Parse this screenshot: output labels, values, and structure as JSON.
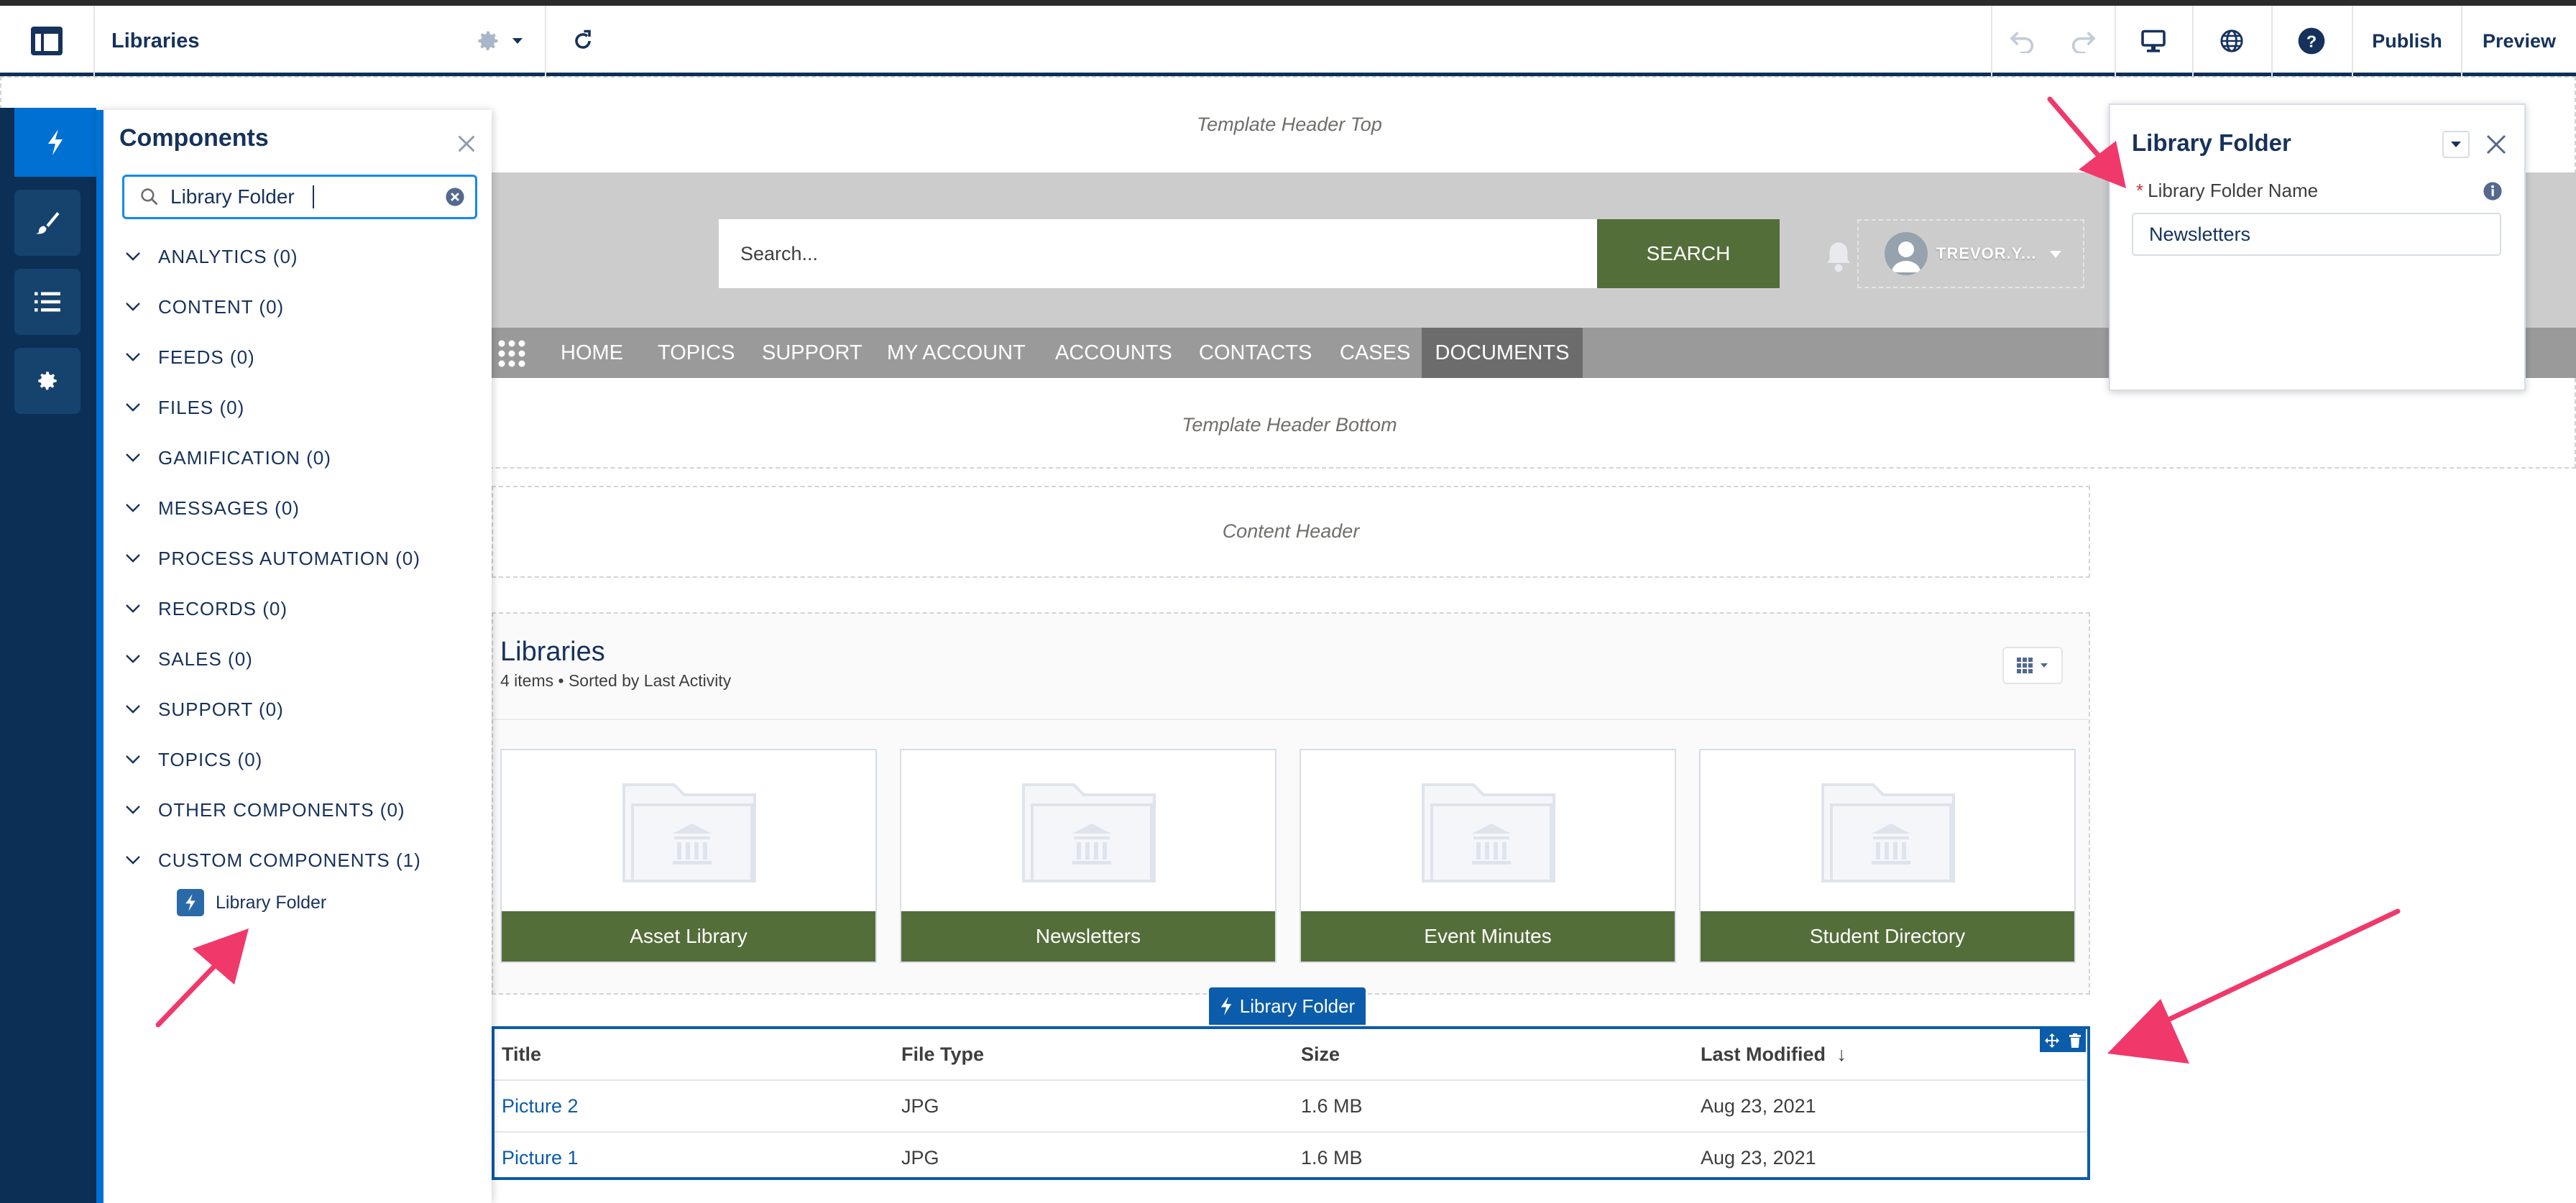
{
  "topbar": {
    "title": "Libraries",
    "publish_label": "Publish",
    "preview_label": "Preview"
  },
  "canvas": {
    "template_header_top": "Template Header Top",
    "template_header_bottom": "Template Header Bottom",
    "content_header": "Content Header",
    "search_placeholder": "Search...",
    "search_button": "SEARCH",
    "user_name": "TREVOR.Y...",
    "nav_items": [
      "HOME",
      "TOPICS",
      "SUPPORT",
      "MY ACCOUNT",
      "ACCOUNTS",
      "CONTACTS",
      "CASES",
      "DOCUMENTS"
    ],
    "nav_active": "DOCUMENTS"
  },
  "components_panel": {
    "title": "Components",
    "search_value": "Library Folder",
    "categories": [
      "ANALYTICS (0)",
      "CONTENT (0)",
      "FEEDS (0)",
      "FILES (0)",
      "GAMIFICATION (0)",
      "MESSAGES (0)",
      "PROCESS AUTOMATION (0)",
      "RECORDS (0)",
      "SALES (0)",
      "SUPPORT (0)",
      "TOPICS (0)",
      "OTHER COMPONENTS (0)",
      "CUSTOM COMPONENTS (1)"
    ],
    "custom_item": "Library Folder"
  },
  "libraries": {
    "title": "Libraries",
    "subtitle": "4 items • Sorted by Last Activity",
    "cards": [
      "Asset Library",
      "Newsletters",
      "Event Minutes",
      "Student Directory"
    ]
  },
  "library_folder": {
    "badge": "Library Folder",
    "columns": [
      "Title",
      "File Type",
      "Size",
      "Last Modified"
    ],
    "sort_indicator": "↓",
    "rows": [
      {
        "title": "Picture 2",
        "file_type": "JPG",
        "size": "1.6 MB",
        "modified": "Aug 23, 2021"
      },
      {
        "title": "Picture 1",
        "file_type": "JPG",
        "size": "1.6 MB",
        "modified": "Aug 23, 2021"
      }
    ]
  },
  "property_panel": {
    "title": "Library Folder",
    "required_mark": "*",
    "field_label": "Library Folder Name",
    "field_value": "Newsletters"
  },
  "colors": {
    "brand_navy": "#0b2f55",
    "accent_blue": "#0070d2",
    "library_green": "#546e3a",
    "annotation_pink": "#f0386b"
  }
}
